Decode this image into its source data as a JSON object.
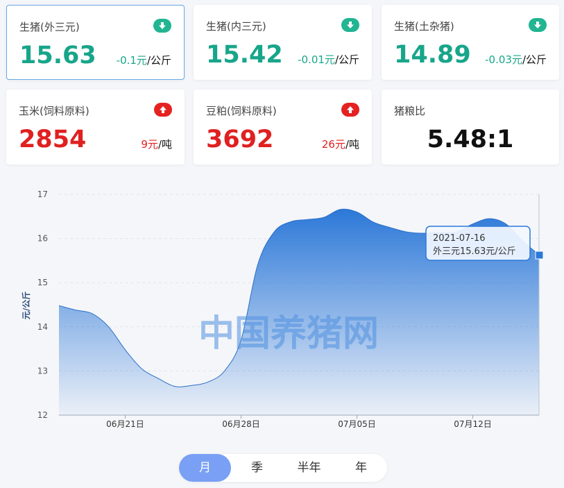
{
  "cards": [
    {
      "name": "生猪(外三元)",
      "value": "15.63",
      "change": "-0.1元",
      "unit": "/公斤",
      "trend": "down-arrow-icon"
    },
    {
      "name": "生猪(内三元)",
      "value": "15.42",
      "change": "-0.01元",
      "unit": "/公斤",
      "trend": "down-arrow-icon"
    },
    {
      "name": "生猪(土杂猪)",
      "value": "14.89",
      "change": "-0.03元",
      "unit": "/公斤",
      "trend": "down-arrow-icon"
    },
    {
      "name": "玉米(饲料原料)",
      "value": "2854",
      "change": "9元",
      "unit": "/吨",
      "trend": "up-arrow-icon"
    },
    {
      "name": "豆粕(饲料原料)",
      "value": "3692",
      "change": "26元",
      "unit": "/吨",
      "trend": "up-arrow-icon"
    },
    {
      "name": "猪粮比",
      "value": "5.48:1"
    }
  ],
  "colors": {
    "down": "#18a58a",
    "up": "#e02020",
    "accent": "#3b82d9"
  },
  "chart_data": {
    "type": "area",
    "ylabel": "元/公斤",
    "ylim": [
      12,
      17
    ],
    "yticks": [
      12,
      13,
      14,
      15,
      16,
      17
    ],
    "xticks": [
      "06月21日",
      "06月28日",
      "07月05日",
      "07月12日"
    ],
    "x": [
      "06-17",
      "06-18",
      "06-19",
      "06-20",
      "06-21",
      "06-22",
      "06-23",
      "06-24",
      "06-25",
      "06-26",
      "06-27",
      "06-28",
      "06-29",
      "06-30",
      "07-01",
      "07-02",
      "07-03",
      "07-04",
      "07-05",
      "07-06",
      "07-07",
      "07-08",
      "07-09",
      "07-10",
      "07-11",
      "07-12",
      "07-13",
      "07-14",
      "07-15",
      "07-16"
    ],
    "values": [
      14.48,
      14.38,
      14.3,
      14.0,
      13.48,
      13.05,
      12.83,
      12.65,
      12.67,
      12.75,
      13.0,
      13.7,
      15.4,
      16.15,
      16.38,
      16.43,
      16.48,
      16.66,
      16.6,
      16.37,
      16.25,
      16.15,
      16.12,
      16.14,
      16.15,
      16.33,
      16.45,
      16.33,
      15.95,
      15.63
    ],
    "watermark": "中国养猪网",
    "tooltip": {
      "date": "2021-07-16",
      "label": "外三元15.63元/公斤"
    },
    "grid": true
  },
  "tabs": [
    {
      "label": "月",
      "active": true
    },
    {
      "label": "季",
      "active": false
    },
    {
      "label": "半年",
      "active": false
    },
    {
      "label": "年",
      "active": false
    }
  ]
}
